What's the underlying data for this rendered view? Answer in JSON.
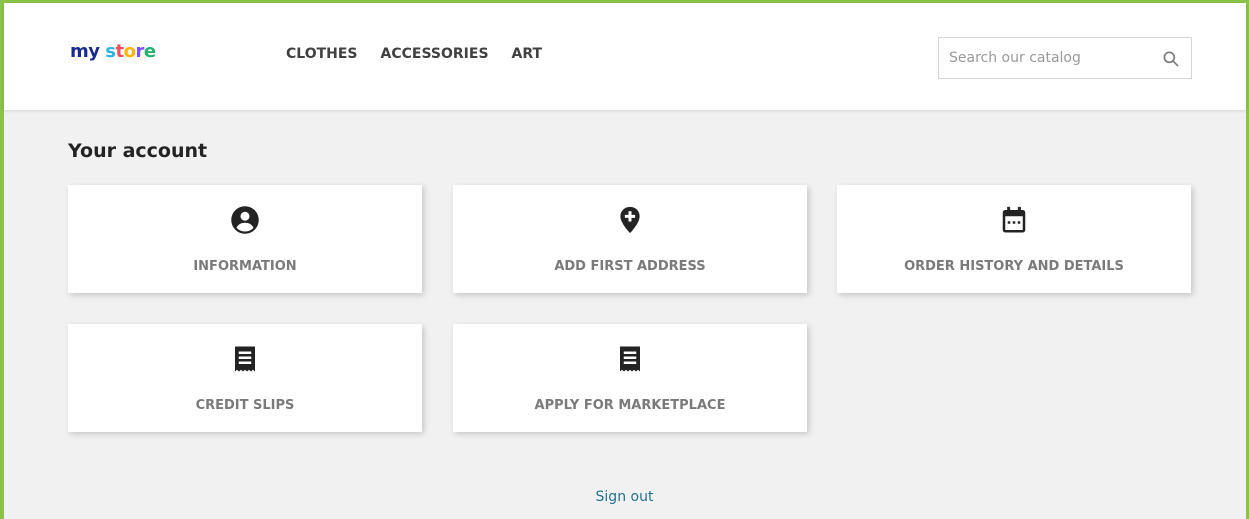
{
  "header": {
    "logo": {
      "part1": "my",
      "part2": "store"
    },
    "nav": [
      {
        "label": "CLOTHES"
      },
      {
        "label": "ACCESSORIES"
      },
      {
        "label": "ART"
      }
    ],
    "search": {
      "placeholder": "Search our catalog",
      "value": "",
      "icon": "search-icon"
    }
  },
  "page": {
    "title": "Your account"
  },
  "cards": [
    {
      "label": "INFORMATION",
      "icon": "account-circle-icon"
    },
    {
      "label": "ADD FIRST ADDRESS",
      "icon": "add-location-icon"
    },
    {
      "label": "ORDER HISTORY AND DETAILS",
      "icon": "calendar-icon"
    },
    {
      "label": "CREDIT SLIPS",
      "icon": "receipt-icon"
    },
    {
      "label": "APPLY FOR MARKETPLACE",
      "icon": "receipt-icon"
    }
  ],
  "footer": {
    "sign_out": "Sign out"
  },
  "colors": {
    "frame_accent": "#8bc34a",
    "background": "#f1f1f1",
    "card_label": "#7a7a7a",
    "link": "#24718f"
  }
}
